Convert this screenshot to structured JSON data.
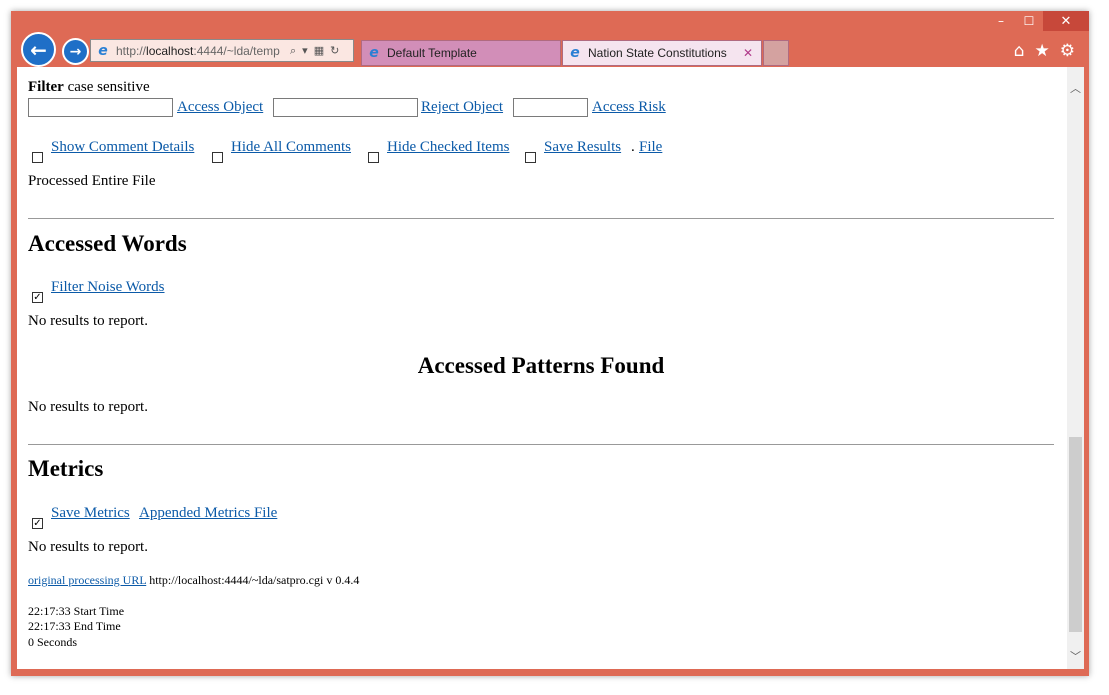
{
  "window": {
    "minimize": "–",
    "maximize": "☐",
    "close": "✕"
  },
  "nav": {
    "back": "←",
    "forward": "→"
  },
  "address": {
    "prefix": "http://",
    "host": "localhost",
    "rest": ":4444/~lda/temp",
    "search": "⌕",
    "dropdown": "▾",
    "compat": "▦",
    "refresh": "↻"
  },
  "tabs": [
    {
      "label": "Default Template"
    },
    {
      "label": "Nation State Constitutions",
      "close": "✕"
    }
  ],
  "toolbar": {
    "home": "⌂",
    "favorites": "★",
    "settings": "⚙"
  },
  "filter": {
    "title": "Filter",
    "subtitle": "case sensitive",
    "access_object": "Access Object",
    "reject_object": "Reject Object",
    "access_risk": "Access Risk",
    "show_comment_details": "Show Comment Details",
    "hide_all_comments": "Hide All Comments",
    "hide_checked_items": "Hide Checked Items",
    "save_results": "Save Results",
    "dot": ".",
    "file": "File",
    "status": "Processed Entire File"
  },
  "accessed_words": {
    "heading": "Accessed Words",
    "filter_noise_words": "Filter Noise Words",
    "no_results": "No results to report."
  },
  "patterns": {
    "heading": "Accessed Patterns Found",
    "no_results": "No results to report."
  },
  "metrics": {
    "heading": "Metrics",
    "save_metrics": "Save Metrics",
    "appended_metrics_file": "Appended Metrics File",
    "no_results": "No results to report."
  },
  "footer": {
    "original_url_link": "original processing URL",
    "url_text": "http://localhost:4444/~lda/satpro.cgi v 0.4.4",
    "start_time": "22:17:33 Start Time",
    "end_time": "22:17:33 End Time",
    "seconds": "0 Seconds"
  },
  "scroll": {
    "up": "︿",
    "down": "﹀"
  },
  "colors": {
    "frame": "#de6a55",
    "link": "#0b5aa8",
    "tab_active": "#f5e4ef",
    "tab_inactive": "#d28eb8"
  }
}
